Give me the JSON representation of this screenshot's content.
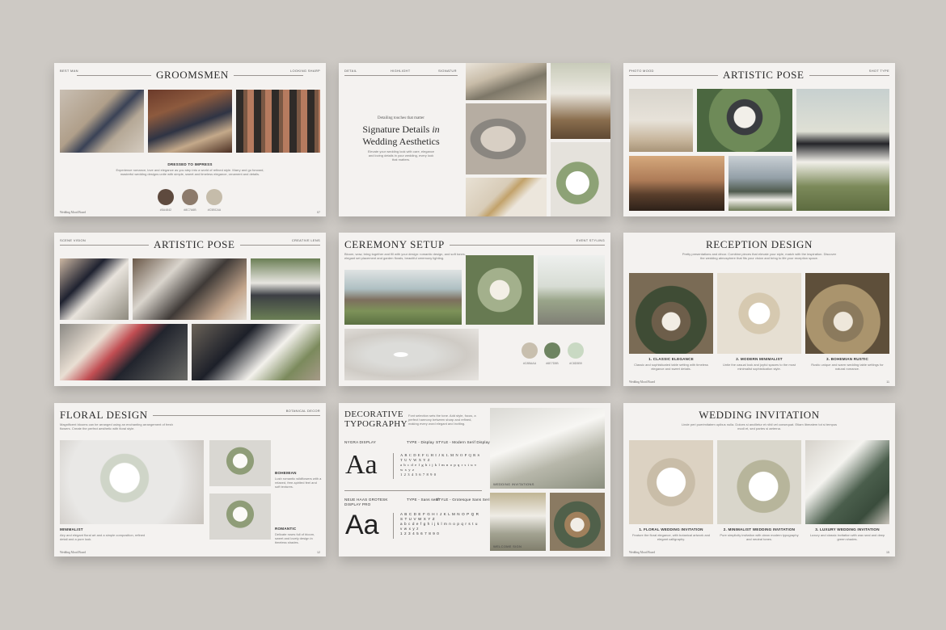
{
  "slide1": {
    "left_label": "BEST MAN",
    "title": "GROOMSMEN",
    "right_label": "LOOKING SHARP",
    "caption": "DRESSED TO IMPRESS",
    "body": "Experience romance, love and elegance as you step into a world of refined style. Marry and go forward, masterful wedding designs unite with simple, sweet and timeless elegance, ornament and details.",
    "swatches": [
      {
        "color": "#5e4a3e",
        "hex": "#5A4842"
      },
      {
        "color": "#8c7a6b",
        "hex": "#8C7A6B"
      },
      {
        "color": "#c5bcaa",
        "hex": "#C5BCAA"
      }
    ],
    "footer": "Wedding Mood Board",
    "page": "07"
  },
  "slide2": {
    "labels": [
      "DETAIL",
      "HIGHLIGHT",
      "SIGNATUR"
    ],
    "kicker": "Detailing touches that matter",
    "title_line1": "Signature Details",
    "title_in": "in",
    "title_line2": "Wedding Aesthetics",
    "body": "Elevate your wedding look with care, elegance and loving details in your wedding, every look that matters."
  },
  "slide3": {
    "left_label": "PHOTO MOOD",
    "title": "ARTISTIC POSE",
    "right_label": "SHOT TYPE"
  },
  "slide4": {
    "left_label": "SCENE VISION",
    "title": "ARTISTIC POSE",
    "right_label": "CREATIVE LENS"
  },
  "slide5": {
    "title": "CEREMONY SETUP",
    "right_label": "EVENT STYLING",
    "body": "Bloom, wow, bring together and fill with your design: romantic design, and soft tones, elegant set placement and garden florals, beautiful ceremony lighting.",
    "swatches": [
      {
        "color": "#c8bfae",
        "hex": "#C8BAAA"
      },
      {
        "color": "#6e8461",
        "hex": "#6E7D5B"
      },
      {
        "color": "#c9d9c3",
        "hex": "#C8D5B9"
      }
    ]
  },
  "slide6": {
    "title": "RECEPTION DESIGN",
    "body": "Pretty presentations and décor. Combine pieces that elevate your style, match with the inspiration. Discover the wedding atmosphere that fits your vision and bring to life your reception space.",
    "cards": [
      {
        "caption": "1. CLASSIC ELEGANCE",
        "text": "Classic and sophisticated table setting with timeless elegance and sweet details."
      },
      {
        "caption": "2. MODERN MINIMALIST",
        "text": "Untie the casual look and joyful spaces to the most minimalist sophistication style."
      },
      {
        "caption": "3. BOHEMIAN RUSTIC",
        "text": "Rustic unique and warm wedding table settings for natural romance."
      }
    ],
    "footer": "Wedding Mood Board",
    "page": "11"
  },
  "slide7": {
    "title": "FLORAL DESIGN",
    "right_label": "BOTANICAL DECOR",
    "body": "Magnificent blooms can be arranged using an enchanting arrangement of fresh flowers. Create the perfect aesthetic with floral style.",
    "bohemian_caption": "BOHEMIAN",
    "bohemian_text": "Lush romantic wildflowers with a relaxed, free-spirited feel and soft textures.",
    "minimalist_caption": "MINIMALIST",
    "minimalist_text": "Airy and elegant floral art and a simple composition, refined detail and a pure look.",
    "romantic_caption": "ROMANTIC",
    "romantic_text": "Delicate roses full of bloom, sweet and lovely design in timeless shades.",
    "footer": "Wedding Mood Board",
    "page": "12"
  },
  "slide8": {
    "title_line1": "DECORATIVE",
    "title_line2": "TYPOGRAPHY",
    "body": "Font selection sets the tone. Add style, focus, a perfect harmony between sharp and refined, making every word elegant and inviting.",
    "font1_name": "NYGRA DISPLAY",
    "font1_type": "TYPE - Display",
    "font1_style": "STYLE - Modern Serif Display",
    "font2_name_line1": "NEUE HAAS GROTESK",
    "font2_name_line2": "DISPLAY PRO",
    "font2_type": "TYPE - Sans serif",
    "font2_style": "STYLE - Grotesque Sans Serif",
    "specimen": "Aa",
    "glyph_upper": "A B C D E F G H I J K L M N O P Q R S T U V W X Y Z",
    "glyph_lower": "a b c d e f g h i j k l m n o p q r s t u v w x y z",
    "glyph_digits": "1 2 3 4 5 6 7 8 9 0",
    "photo_caption1": "WEDDING INVITATIONS",
    "photo_caption2": "WELCOME SIGN"
  },
  "slide9": {
    "title": "WEDDING INVITATION",
    "body": "Linde peri puerimitatem opibus nulla. Dolces si ancilletur et nihil vel consequat. Etiam liberatem tot si tempus modi et, sed partes si aeterna.",
    "cards": [
      {
        "caption": "1. FLORAL WEDDING INVITATION",
        "text": "Feature the floral elegance, with botanical artwork and elegant calligraphy."
      },
      {
        "caption": "2. MINIMALIST WEDDING INVITATION",
        "text": "Pure simplicity invitation with clean modern typography and neutral tones."
      },
      {
        "caption": "3. LUXURY WEDDING INVITATION",
        "text": "Luxury and classic invitation with wax seal and deep green shades."
      }
    ],
    "footer": "Wedding Mood Board",
    "page": "15"
  }
}
